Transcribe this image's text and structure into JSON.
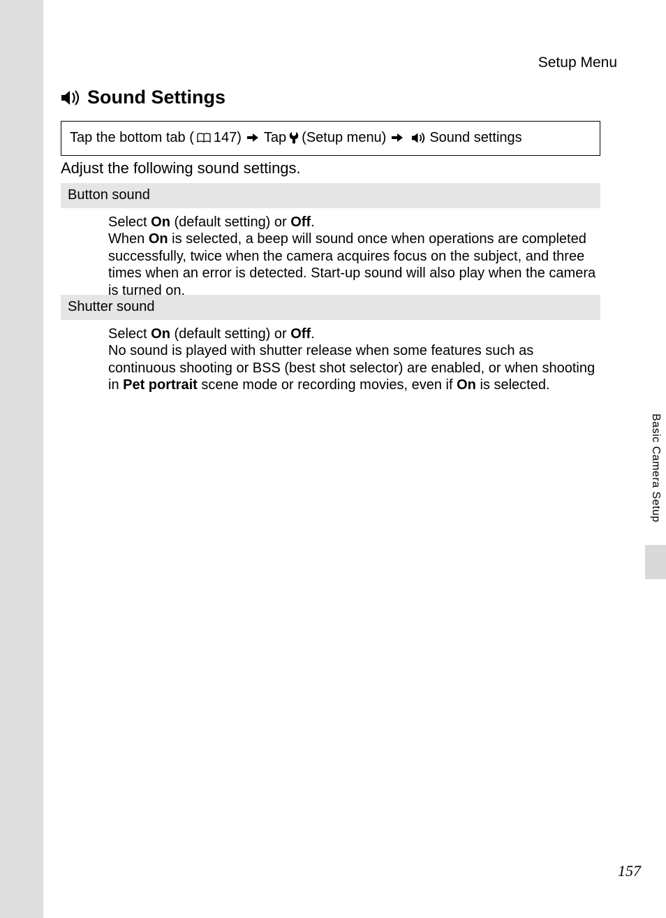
{
  "header": {
    "label": "Setup Menu"
  },
  "section": {
    "title": "Sound Settings"
  },
  "breadcrumb": {
    "part1": "Tap the bottom tab (",
    "page_ref": " 147) ",
    "part2": " Tap ",
    "part3": " (Setup menu) ",
    "part4": " Sound settings"
  },
  "intro": "Adjust the following sound settings.",
  "options": [
    {
      "header": "Button sound",
      "body_pre1": "Select ",
      "body_b1": "On",
      "body_mid1": " (default setting) or ",
      "body_b2": "Off",
      "body_post1": ".",
      "body_line2a": "When ",
      "body_line2b": "On",
      "body_line2c": " is selected, a beep will sound once when operations are completed successfully, twice when the camera acquires focus on the subject, and three times when an error is detected. Start-up sound will also play when the camera is turned on."
    },
    {
      "header": "Shutter sound",
      "body_pre1": "Select ",
      "body_b1": "On",
      "body_mid1": " (default setting) or ",
      "body_b2": "Off",
      "body_post1": ".",
      "body_line2a": "No sound is played with shutter release when some features such as continuous shooting or BSS (best shot selector) are enabled, or when shooting in ",
      "body_line2b": "Pet portrait",
      "body_line2c": " scene mode or recording movies, even if ",
      "body_line2d": "On",
      "body_line2e": " is selected."
    }
  ],
  "side_tab": "Basic Camera Setup",
  "page_number": "157"
}
